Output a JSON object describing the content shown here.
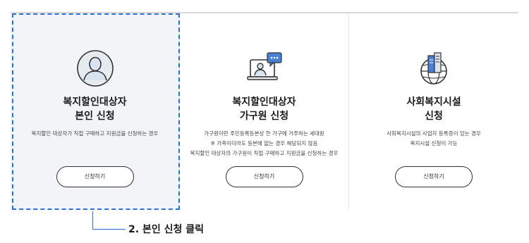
{
  "cards": [
    {
      "title_line1": "복지할인대상자",
      "title_line2": "본인 신청",
      "desc": [
        "복지할인 대상자가 직접 구매하고 지원금을 신청하는 경우"
      ],
      "button": "신청하기",
      "icon": "person-icon"
    },
    {
      "title_line1": "복지할인대상자",
      "title_line2": "가구원 신청",
      "desc": [
        "가구원이란 주민등록등본상 한 가구에 거주하는 세대원",
        "※ 가족이더라도 등본에 없는 경우 해당되지 않음",
        "복지할인 대상자의 가구원이 직접 구매하고 지원금을 신청하는 경우"
      ],
      "button": "신청하기",
      "icon": "video-chat-icon"
    },
    {
      "title_line1": "사회복지시설",
      "title_line2": "신청",
      "desc": [
        "사회복지시설의 사업자 등록증이 있는 경우",
        "복지시설 신청이 가능"
      ],
      "button": "신청하기",
      "icon": "globe-building-icon"
    }
  ],
  "callout": {
    "text": "2. 본인 신청 클릭"
  },
  "colors": {
    "accent": "#2f6ed8",
    "selected_bg": "#f2f5f8"
  }
}
